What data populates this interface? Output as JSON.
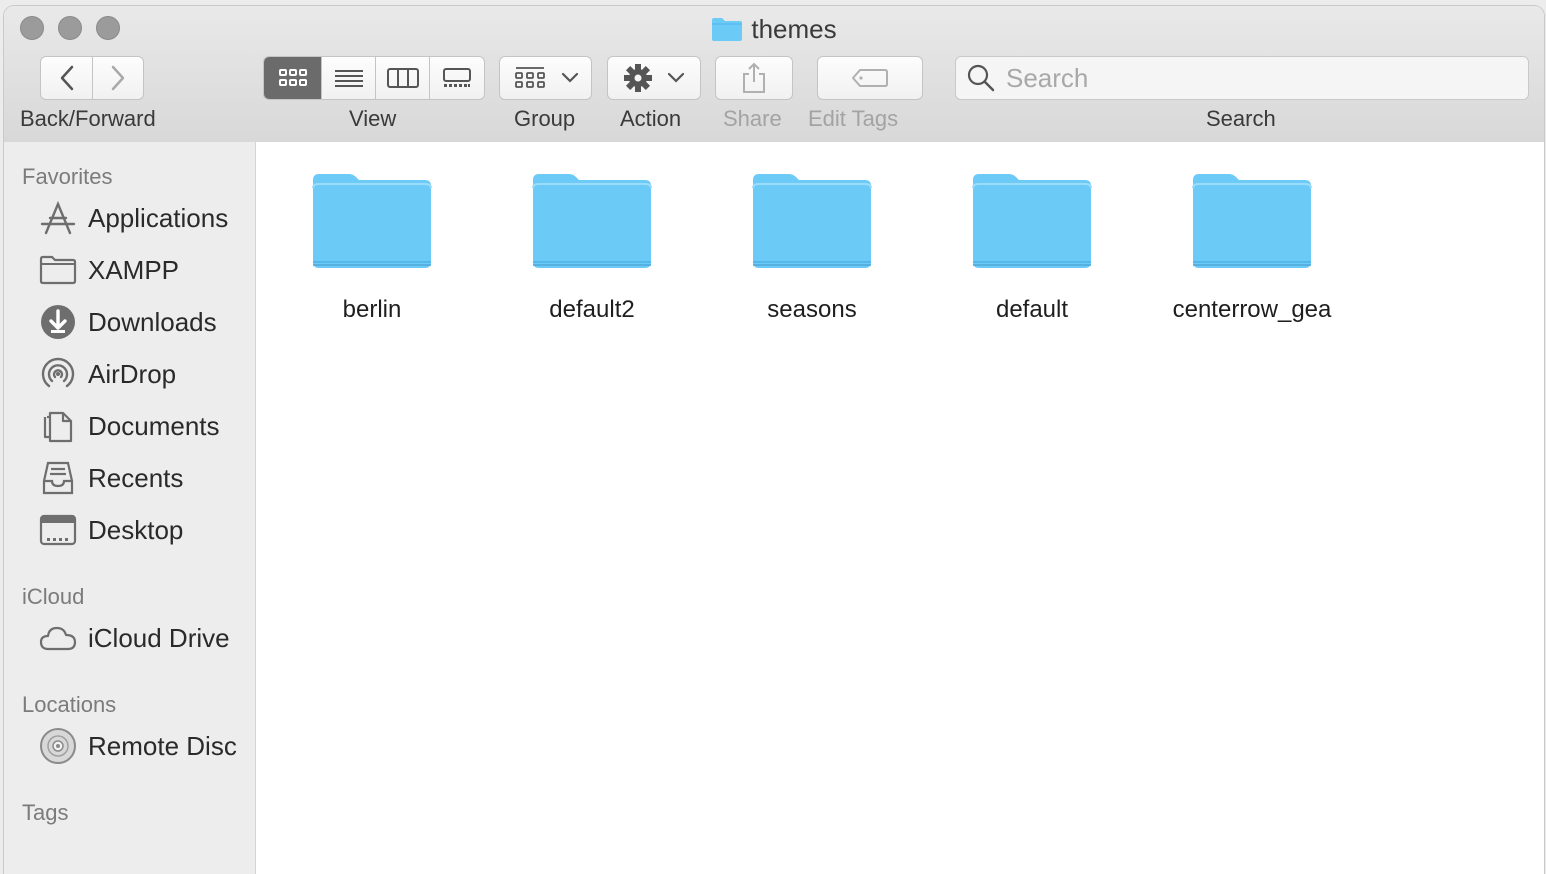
{
  "window": {
    "title": "themes"
  },
  "toolbar": {
    "back_forward_label": "Back/Forward",
    "view_label": "View",
    "group_label": "Group",
    "action_label": "Action",
    "share_label": "Share",
    "edit_tags_label": "Edit Tags",
    "search_label": "Search"
  },
  "search": {
    "placeholder": "Search",
    "value": ""
  },
  "sidebar": {
    "favorites_heading": "Favorites",
    "favorites": [
      {
        "label": "Applications",
        "icon": "applications-icon"
      },
      {
        "label": "XAMPP",
        "icon": "folder-icon"
      },
      {
        "label": "Downloads",
        "icon": "downloads-icon"
      },
      {
        "label": "AirDrop",
        "icon": "airdrop-icon"
      },
      {
        "label": "Documents",
        "icon": "documents-icon"
      },
      {
        "label": "Recents",
        "icon": "recents-icon"
      },
      {
        "label": "Desktop",
        "icon": "desktop-icon"
      }
    ],
    "icloud_heading": "iCloud",
    "icloud": [
      {
        "label": "iCloud Drive",
        "icon": "cloud-icon"
      }
    ],
    "locations_heading": "Locations",
    "locations": [
      {
        "label": "Remote Disc",
        "icon": "disc-icon"
      }
    ],
    "tags_heading": "Tags"
  },
  "files": [
    {
      "name": "berlin"
    },
    {
      "name": "default2"
    },
    {
      "name": "seasons"
    },
    {
      "name": "default"
    },
    {
      "name": "centerrow_gea"
    }
  ],
  "colors": {
    "folder": "#6ccaf7",
    "folder_dark": "#4fb6ee"
  }
}
